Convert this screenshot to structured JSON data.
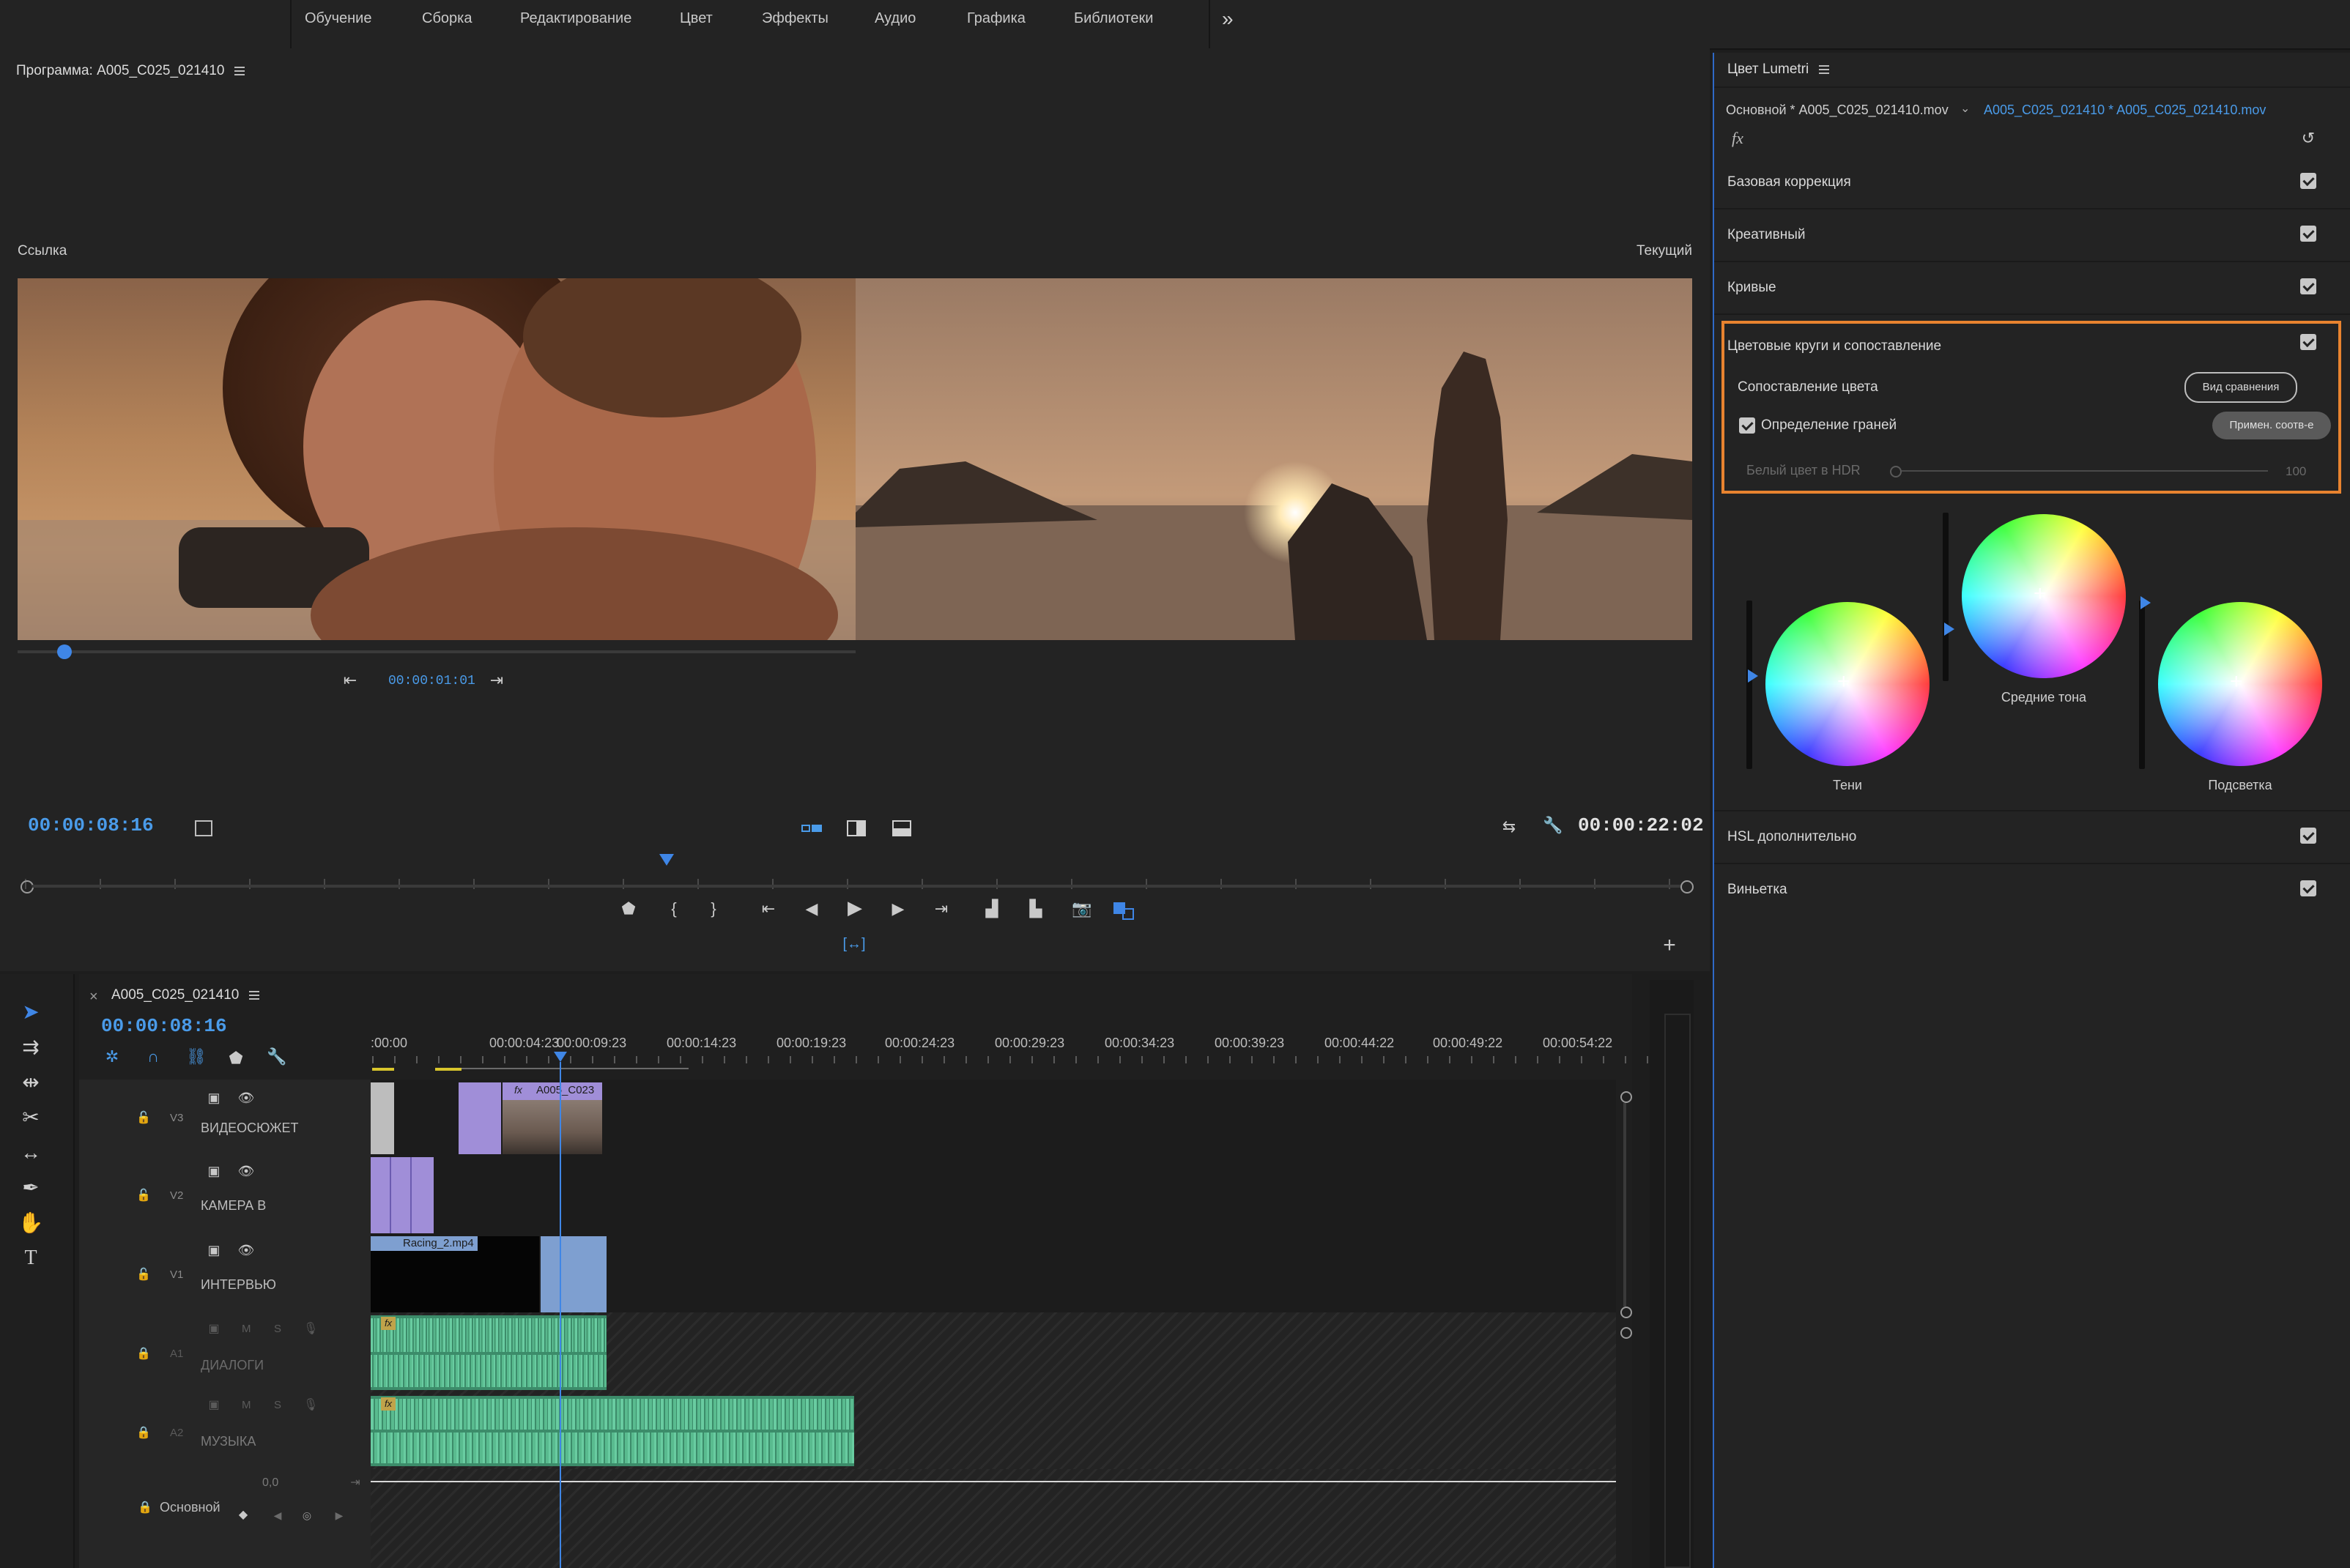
{
  "workspaces": {
    "items": [
      "Обучение",
      "Сборка",
      "Редактирование",
      "Цвет",
      "Эффекты",
      "Аудио",
      "Графика",
      "Библиотеки"
    ],
    "overflow_icon": "chevron-double-right-icon"
  },
  "program_monitor": {
    "title": "Программа: A005_C025_021410",
    "reference_label": "Ссылка",
    "current_label": "Текущий",
    "reference_timecode": "00:00:01:01",
    "playhead_timecode": "00:00:08:16",
    "duration_timecode": "00:00:22:02"
  },
  "timeline": {
    "sequence_name": "A005_C025_021410",
    "close_glyph": "×",
    "playhead_timecode": "00:00:08:16",
    "ruler_labels": [
      ":00:00",
      "00:00:04:23",
      "00:00:09:23",
      "00:00:14:23",
      "00:00:19:23",
      "00:00:24:23",
      "00:00:29:23",
      "00:00:34:23",
      "00:00:39:23",
      "00:00:44:22",
      "00:00:49:22",
      "00:00:54:22"
    ],
    "tracks": {
      "v3": {
        "id": "V3",
        "name": "ВИДЕОСЮЖЕТ"
      },
      "v2": {
        "id": "V2",
        "name": "КАМЕРА B"
      },
      "v1": {
        "id": "V1",
        "name": "ИНТЕРВЬЮ"
      },
      "a1": {
        "id": "A1",
        "name": "ДИАЛОГИ",
        "m": "M",
        "s": "S"
      },
      "a2": {
        "id": "A2",
        "name": "МУЗЫКА",
        "m": "M",
        "s": "S"
      },
      "master": {
        "name": "Основной",
        "value": "0,0"
      }
    },
    "clips": {
      "v3_clip": "A005_C023",
      "v1_clip": "Racing_2.mp4",
      "fx": "fx"
    }
  },
  "lumetri": {
    "title": "Цвет Lumetri",
    "source_master": "Основной * A005_C025_021410.mov",
    "source_clip": "A005_C025_021410 * A005_C025_021410.mov",
    "fx": "fx",
    "sections": {
      "basic": "Базовая коррекция",
      "creative": "Креативный",
      "curves": "Кривые",
      "wheels": "Цветовые круги и сопоставление",
      "hsl": "HSL дополнительно",
      "vignette": "Виньетка"
    },
    "color_match": {
      "label": "Сопоставление цвета",
      "compare_button": "Вид сравнения",
      "face_detection": "Определение граней",
      "apply_button": "Примен. соотв-е",
      "hdr_label": "Белый цвет в HDR",
      "hdr_value": "100"
    },
    "wheels": {
      "shadows": "Тени",
      "midtones": "Средние тона",
      "highlights": "Подсветка"
    }
  },
  "colors": {
    "accent_blue": "#4a9be9",
    "highlight_orange": "#e8832f",
    "video_clip_purple": "#a08ed8",
    "video_clip_blue": "#7e9fd0",
    "audio_clip_green": "#62c49a"
  }
}
